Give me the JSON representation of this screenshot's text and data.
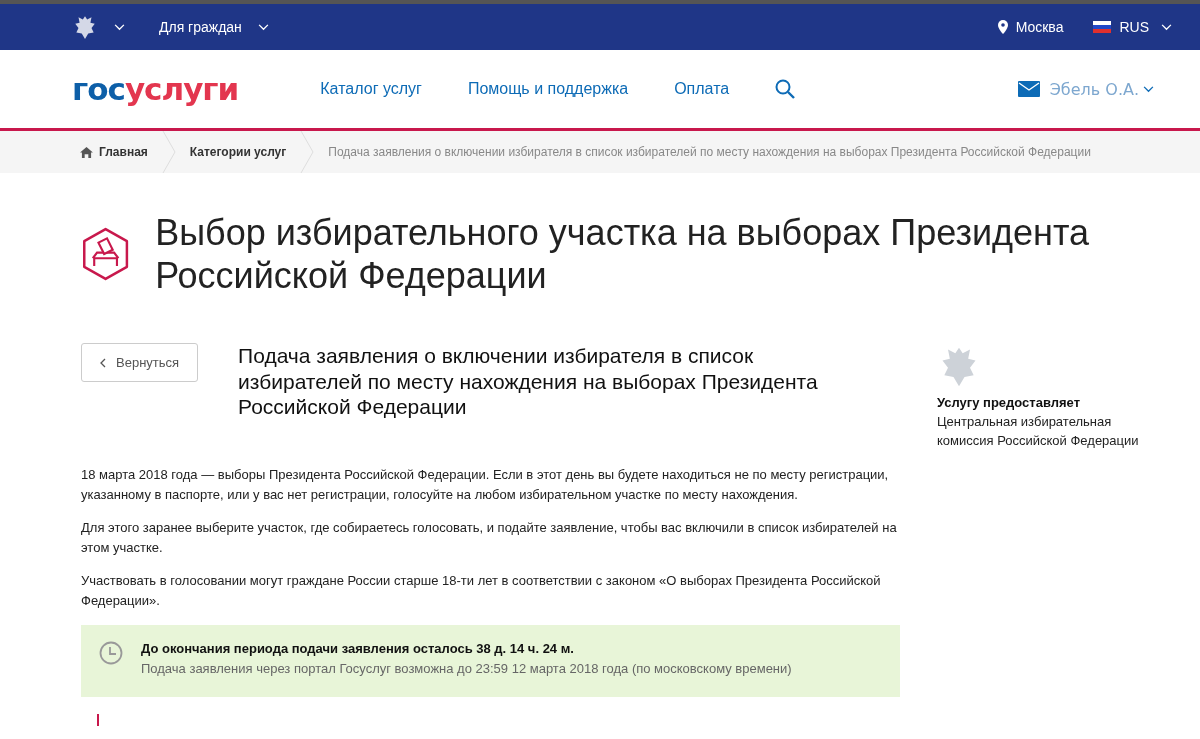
{
  "top_bar": {
    "audience": "Для граждан",
    "city": "Москва",
    "language": "RUS"
  },
  "header": {
    "logo_prefix": "гос",
    "logo_suffix": "услуги",
    "nav": [
      "Каталог услуг",
      "Помощь и поддержка",
      "Оплата"
    ],
    "user": "Эбель О.А."
  },
  "breadcrumbs": [
    {
      "label": "Главная",
      "kind": "home"
    },
    {
      "label": "Категории услуг",
      "kind": "link"
    },
    {
      "label": "Подача заявления о включении избирателя в список избирателей по месту нахождения на выборах Президента Российской Федерации",
      "kind": "current"
    }
  ],
  "page_title": "Выбор избирательного участка на выборах Президента Российской Федерации",
  "back_button": "Вернуться",
  "service_title": "Подача заявления о включении избирателя в список избирателей по месту нахождения на выборах Президента Российской Федерации",
  "provider": {
    "label": "Услугу предоставляет",
    "name": "Центральная избирательная комиссия Российской Федерации"
  },
  "paragraphs": [
    "18 марта 2018 года — выборы Президента Российской Федерации. Если в этот день вы будете находиться не по месту регистрации, указанному в паспорте, или у вас нет регистрации, голосуйте на любом избирательном участке по месту нахождения.",
    "Для этого заранее выберите участок, где собираетесь голосовать, и подайте заявление, чтобы вас включили в список избирателей на этом участке.",
    "Участвовать в голосовании могут граждане России старше 18-ти лет в соответствии с законом «О выборах Президента Российской Федерации»."
  ],
  "deadline": {
    "title": "До окончания периода подачи заявления осталось 38 д. 14 ч. 24 м.",
    "note": "Подача заявления через портал Госуслуг возможна до 23:59 12 марта 2018 года (по московскому времени)"
  }
}
